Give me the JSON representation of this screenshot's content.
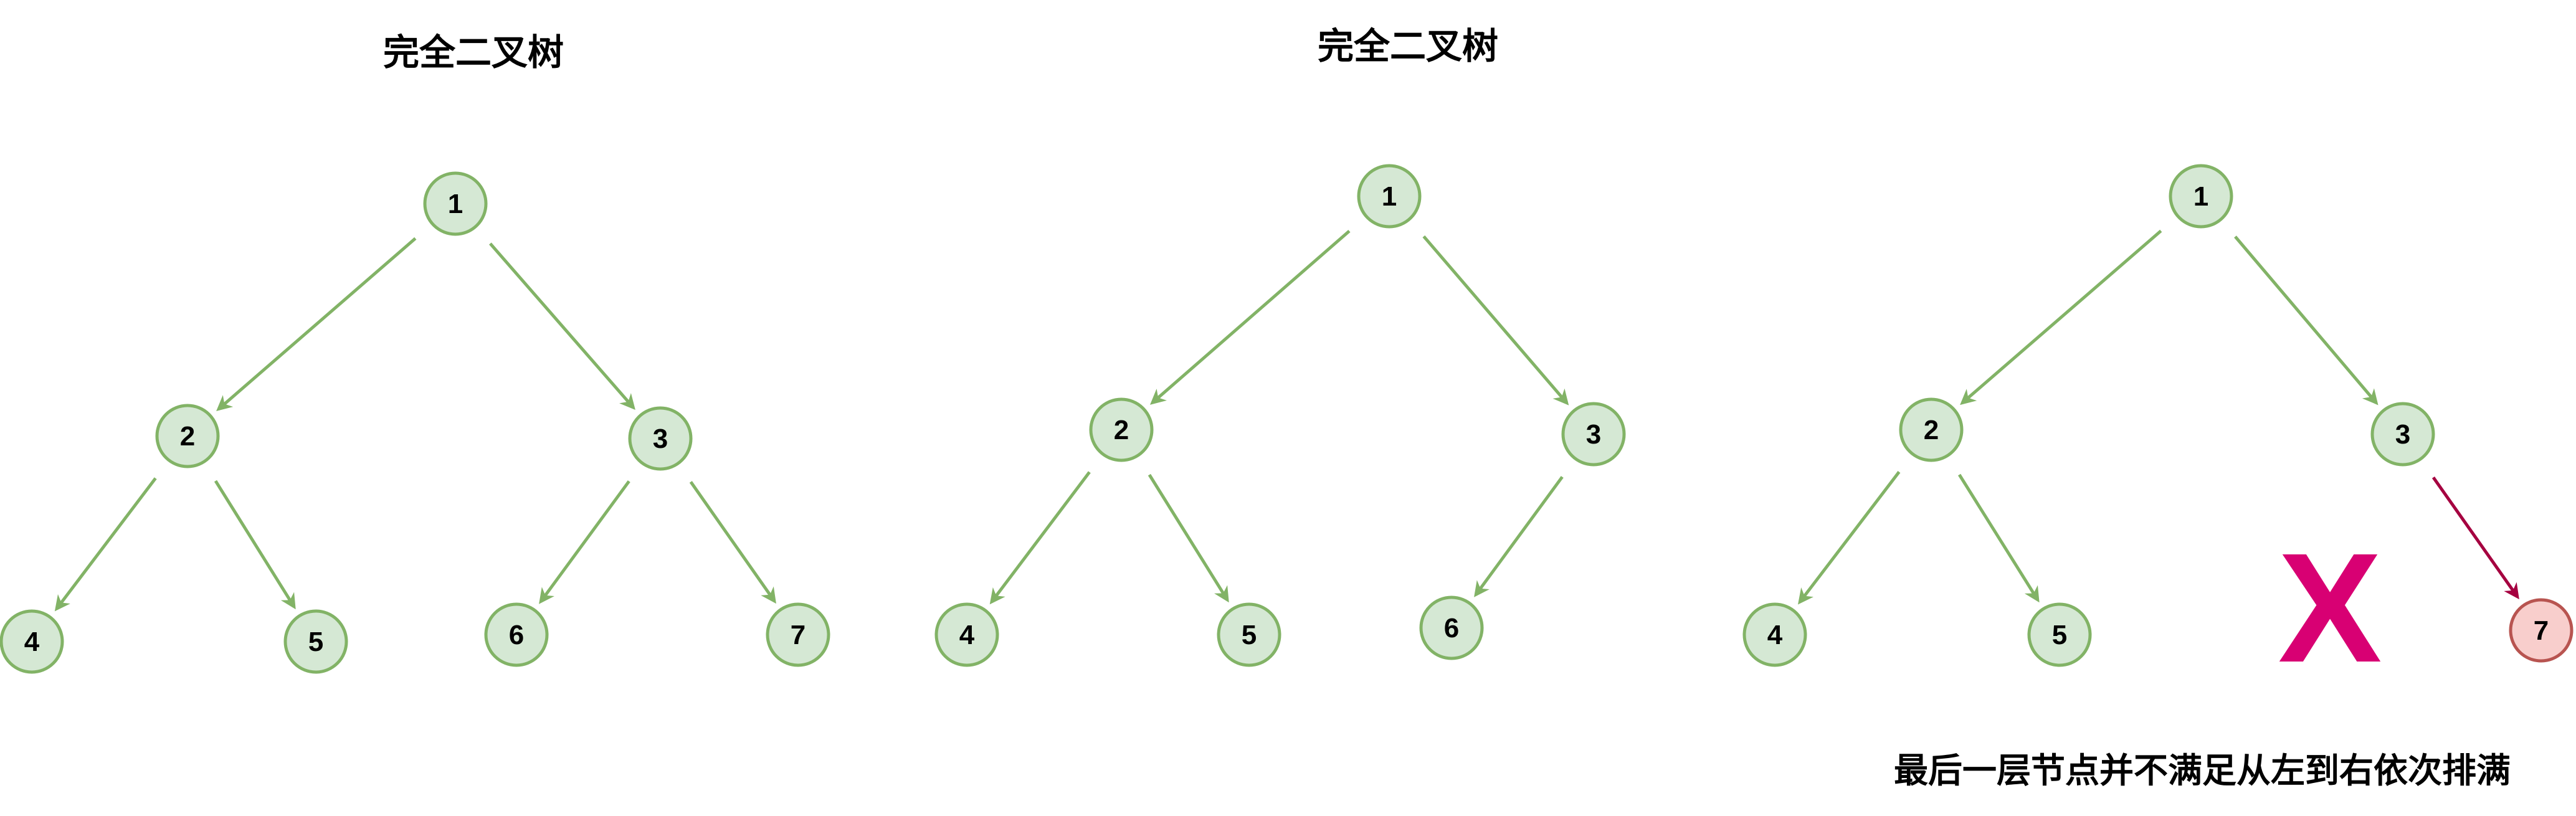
{
  "colors": {
    "node_fill": "#d5e8d4",
    "node_stroke": "#82b366",
    "edge": "#82b366",
    "invalid_node_fill": "#f8cecc",
    "invalid_node_stroke": "#b85450",
    "invalid_edge": "#a50040",
    "cross_mark": "#d80073",
    "label": "#000000"
  },
  "diagrams": [
    {
      "title": "完全二叉树",
      "nodes": [
        {
          "id": "n1",
          "label": "1"
        },
        {
          "id": "n2",
          "label": "2"
        },
        {
          "id": "n3",
          "label": "3"
        },
        {
          "id": "n4",
          "label": "4"
        },
        {
          "id": "n5",
          "label": "5"
        },
        {
          "id": "n6",
          "label": "6"
        },
        {
          "id": "n7",
          "label": "7"
        }
      ],
      "edges": [
        {
          "from": "n1",
          "to": "n2"
        },
        {
          "from": "n1",
          "to": "n3"
        },
        {
          "from": "n2",
          "to": "n4"
        },
        {
          "from": "n2",
          "to": "n5"
        },
        {
          "from": "n3",
          "to": "n6"
        },
        {
          "from": "n3",
          "to": "n7"
        }
      ]
    },
    {
      "title": "完全二叉树",
      "nodes": [
        {
          "id": "n1",
          "label": "1"
        },
        {
          "id": "n2",
          "label": "2"
        },
        {
          "id": "n3",
          "label": "3"
        },
        {
          "id": "n4",
          "label": "4"
        },
        {
          "id": "n5",
          "label": "5"
        },
        {
          "id": "n6",
          "label": "6"
        }
      ],
      "edges": [
        {
          "from": "n1",
          "to": "n2"
        },
        {
          "from": "n1",
          "to": "n3"
        },
        {
          "from": "n2",
          "to": "n4"
        },
        {
          "from": "n2",
          "to": "n5"
        },
        {
          "from": "n3",
          "to": "n6"
        }
      ]
    },
    {
      "title": "",
      "caption": "最后一层节点并不满足从左到右依次排满",
      "cross_mark": "X",
      "nodes": [
        {
          "id": "n1",
          "label": "1"
        },
        {
          "id": "n2",
          "label": "2"
        },
        {
          "id": "n3",
          "label": "3"
        },
        {
          "id": "n4",
          "label": "4"
        },
        {
          "id": "n5",
          "label": "5"
        },
        {
          "id": "n7",
          "label": "7",
          "invalid": true
        }
      ],
      "edges": [
        {
          "from": "n1",
          "to": "n2"
        },
        {
          "from": "n1",
          "to": "n3"
        },
        {
          "from": "n2",
          "to": "n4"
        },
        {
          "from": "n2",
          "to": "n5"
        },
        {
          "from": "n3",
          "to": "n7",
          "invalid": true
        }
      ]
    }
  ]
}
